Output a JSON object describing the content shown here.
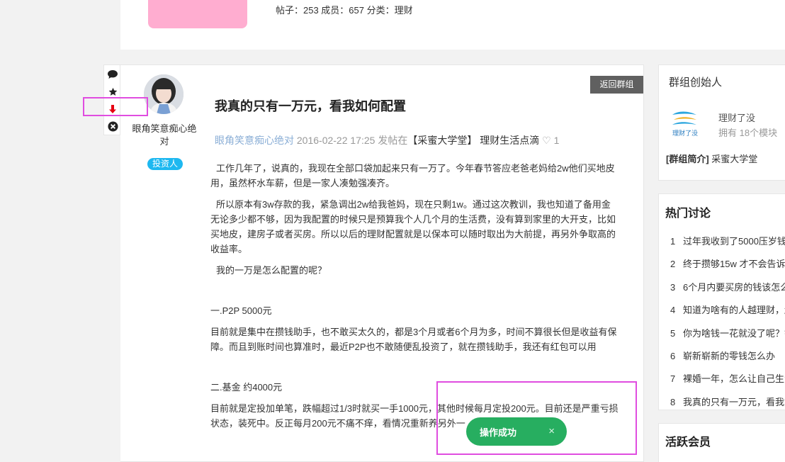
{
  "group": {
    "stats": "帖子：253 成员：657 分类：理财"
  },
  "toolbar": {
    "icons": [
      "comment-icon",
      "star-icon",
      "arrow-down-icon",
      "close-circle-icon"
    ],
    "colors": {
      "arrow": "#e60012"
    }
  },
  "post": {
    "back_label": "返回群组",
    "title": "我真的只有一万元，看我如何配置",
    "author": "眼角笑意痴心绝对",
    "author_badge": "投资人",
    "meta": {
      "author": "眼角笑意痴心绝对",
      "datetime": "2016-02-22 17:25",
      "posted_in": "发帖在",
      "group": "【采蜜大学堂】 理财生活点滴",
      "heart": "♡",
      "likes": "1"
    },
    "paragraphs": [
      "工作几年了，说真的，我现在全部口袋加起来只有一万了。今年春节答应老爸老妈给2w他们买地皮用，虽然杯水车薪，但是一家人凑勉强凑齐。",
      "所以原本有3w存款的我，紧急调出2w给我爸妈，现在只剩1w。通过这次教训，我也知道了备用金无论多少都不够，因为我配置的时候只是预算我个人几个月的生活费，没有算到家里的大开支，比如买地皮，建房子或者买房。所以以后的理财配置就是以保本可以随时取出为大前提，再另外争取高的收益率。",
      "我的一万是怎么配置的呢？",
      "一.P2P  5000元",
      "目前就是集中在攒钱助手，也不敢买太久的，都是3个月或者6个月为多，时间不算很长但是收益有保障。而且到账时间也算准时，最近P2P也不敢随便乱投资了，就在攒钱助手，我还有红包可以用",
      "二.基金 约4000元",
      "目前就是定投加单笔，跌幅超过1/3时就买一手1000元，其他时候每月定投200元。目前还是严重亏损状态，装死中。反正每月200元不痛不痒，看情况重新养另外一"
    ]
  },
  "toast": {
    "message": "操作成功",
    "close": "×",
    "color": "#27ae60"
  },
  "sidebar": {
    "founder": {
      "heading": "群组创始人",
      "logo_text": "理财了没",
      "name": "理财了没",
      "modules": "拥有 18个模块",
      "intro_label": "[群组简介]",
      "intro_value": "采蜜大学堂"
    },
    "hot": {
      "heading": "热门讨论",
      "items": [
        {
          "n": "1",
          "text": "过年我收到了5000压岁钱"
        },
        {
          "n": "2",
          "text": "终于攒够15w 才不会告诉"
        },
        {
          "n": "3",
          "text": "6个月内要买房的钱该怎么"
        },
        {
          "n": "4",
          "text": "知道为啥有的人越理财，越"
        },
        {
          "n": "5",
          "text": "你为啥钱一花就没了呢？钱"
        },
        {
          "n": "6",
          "text": "崭新崭新的零钱怎么办"
        },
        {
          "n": "7",
          "text": "裸婚一年，怎么让自己生活"
        },
        {
          "n": "8",
          "text": "我真的只有一万元，看我如"
        }
      ]
    },
    "active": {
      "heading": "活跃会员"
    }
  }
}
